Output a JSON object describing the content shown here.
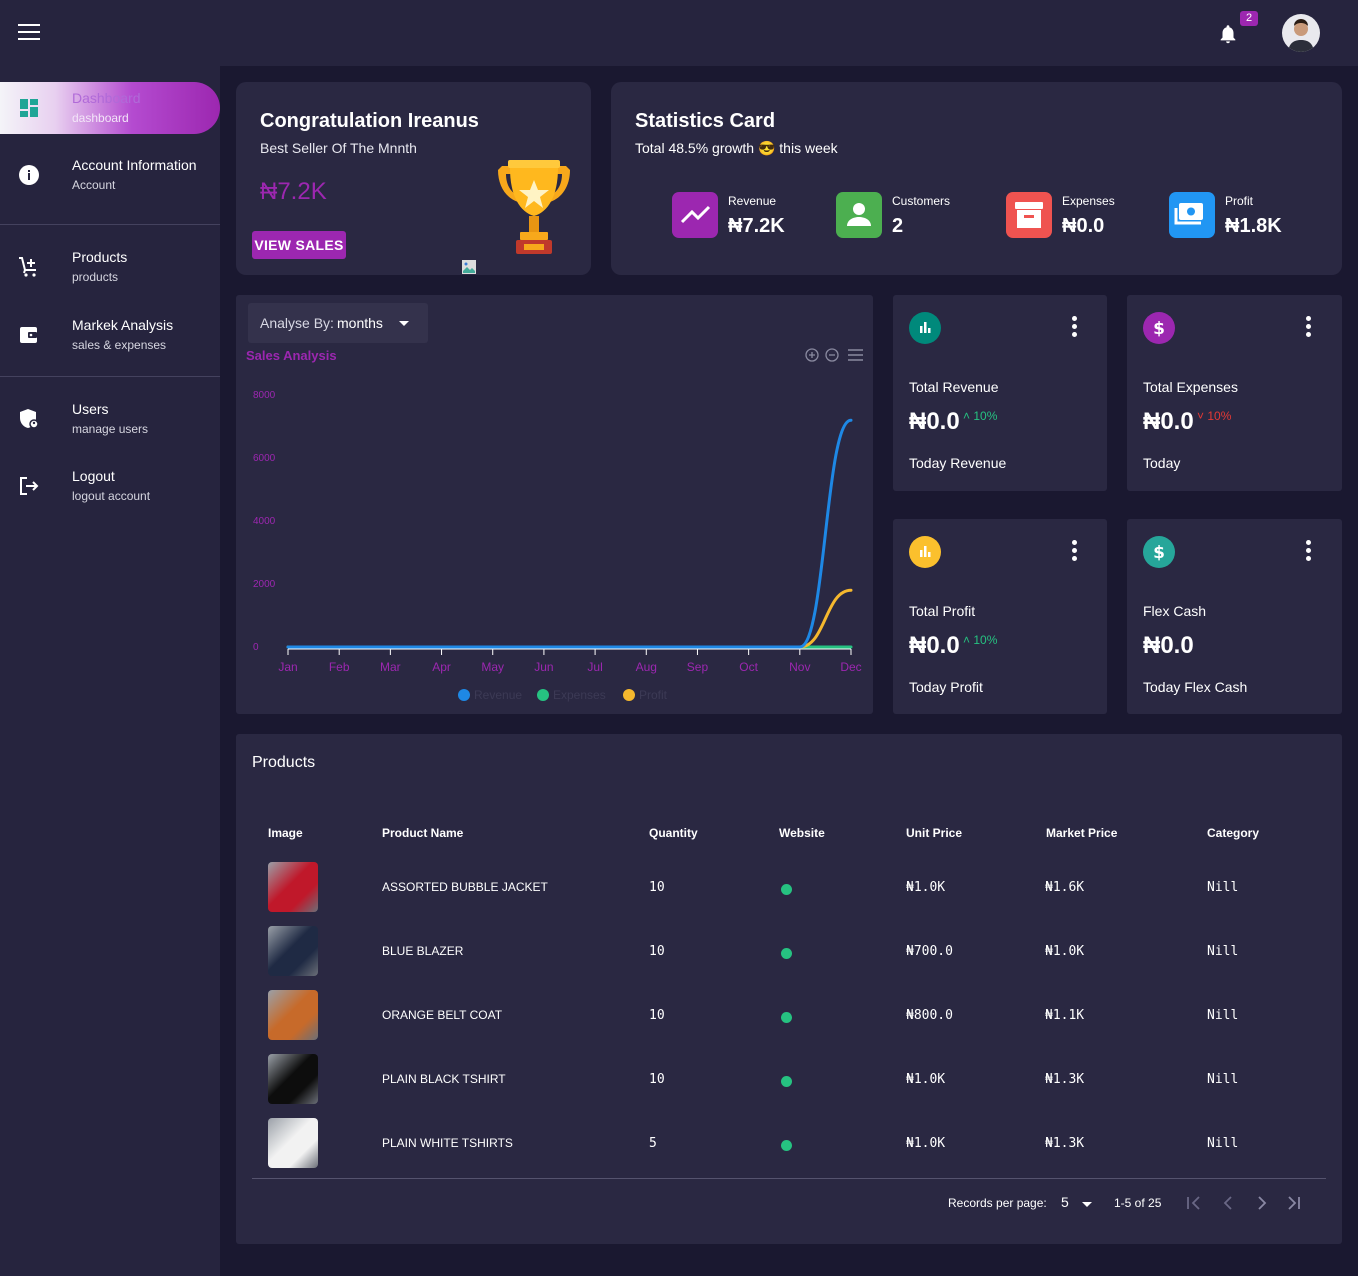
{
  "topbar": {
    "notification_count": "2"
  },
  "sidebar": {
    "items": [
      {
        "label": "Dashboard",
        "sub": "dashboard"
      },
      {
        "label": "Account Information",
        "sub": "Account"
      },
      {
        "label": "Products",
        "sub": "products"
      },
      {
        "label": "Markek Analysis",
        "sub": "sales & expenses"
      },
      {
        "label": "Users",
        "sub": "manage users"
      },
      {
        "label": "Logout",
        "sub": "logout account"
      }
    ]
  },
  "congrats": {
    "title": "Congratulation Ireanus",
    "subtitle": "Best Seller Of The Mnnth",
    "value": "₦7.2K",
    "button": "VIEW SALES"
  },
  "statistics": {
    "title": "Statistics Card",
    "subtitle_before": "Total 48.5% growth",
    "subtitle_emoji": "😎",
    "subtitle_after": "this week",
    "items": [
      {
        "label": "Revenue",
        "value": "₦7.2K",
        "color": "#9c27b0",
        "icon": "trending-up-icon"
      },
      {
        "label": "Customers",
        "value": "2",
        "color": "#4caf50",
        "icon": "person-icon"
      },
      {
        "label": "Expenses",
        "value": "₦0.0",
        "color": "#ef5350",
        "icon": "archive-icon"
      },
      {
        "label": "Profit",
        "value": "₦1.8K",
        "color": "#2196f3",
        "icon": "money-icon"
      }
    ]
  },
  "analysis": {
    "analyse_label": "Analyse By:",
    "analyse_value": "months"
  },
  "chart_data": {
    "type": "line",
    "title": "Sales Analysis",
    "categories": [
      "Jan",
      "Feb",
      "Mar",
      "Apr",
      "May",
      "Jun",
      "Jul",
      "Aug",
      "Sep",
      "Oct",
      "Nov",
      "Dec"
    ],
    "ylim": [
      0,
      8000
    ],
    "yticks": [
      "8000",
      "6000",
      "4000",
      "2000",
      "0"
    ],
    "legend_position": "bottom",
    "series": [
      {
        "name": "Revenue",
        "color": "#1e88e5",
        "values": [
          0,
          0,
          0,
          0,
          0,
          0,
          0,
          0,
          0,
          0,
          0,
          7200
        ]
      },
      {
        "name": "Expenses",
        "color": "#26c281",
        "values": [
          0,
          0,
          0,
          0,
          0,
          0,
          0,
          0,
          0,
          0,
          0,
          0
        ]
      },
      {
        "name": "Profit",
        "color": "#f5b82e",
        "values": [
          0,
          0,
          0,
          0,
          0,
          0,
          0,
          0,
          0,
          0,
          0,
          1800
        ]
      }
    ]
  },
  "mini_cards": [
    {
      "label": "Total Revenue",
      "value": "₦0.0",
      "pct": "10%",
      "trend": "up",
      "sub": "Today Revenue",
      "color": "#00897b",
      "icon": "bar-chart-icon"
    },
    {
      "label": "Total Expenses",
      "value": "₦0.0",
      "pct": "10%",
      "trend": "down",
      "sub": "Today",
      "color": "#9c27b0",
      "icon": "dollar-icon"
    },
    {
      "label": "Total Profit",
      "value": "₦0.0",
      "pct": "10%",
      "trend": "up",
      "sub": "Today Profit",
      "color": "#fbc02d",
      "icon": "bar-chart-icon"
    },
    {
      "label": "Flex Cash",
      "value": "₦0.0",
      "pct": "",
      "trend": "",
      "sub": "Today Flex Cash",
      "color": "#26a69a",
      "icon": "dollar-icon"
    }
  ],
  "products": {
    "title": "Products",
    "columns": [
      "Image",
      "Product Name",
      "Quantity",
      "Website",
      "Unit Price",
      "Market Price",
      "Category"
    ],
    "rows": [
      {
        "name": "ASSORTED BUBBLE JACKET",
        "qty": "10",
        "unit": "₦1.0K",
        "market": "₦1.6K",
        "category": "Nill",
        "thumb": "#c0182a"
      },
      {
        "name": "BLUE BLAZER",
        "qty": "10",
        "unit": "₦700.0",
        "market": "₦1.0K",
        "category": "Nill",
        "thumb": "#1f2a44"
      },
      {
        "name": "ORANGE BELT COAT",
        "qty": "10",
        "unit": "₦800.0",
        "market": "₦1.1K",
        "category": "Nill",
        "thumb": "#c76a2a"
      },
      {
        "name": "PLAIN BLACK TSHIRT",
        "qty": "10",
        "unit": "₦1.0K",
        "market": "₦1.3K",
        "category": "Nill",
        "thumb": "#0d0d0d"
      },
      {
        "name": "PLAIN WHITE TSHIRTS",
        "qty": "5",
        "unit": "₦1.0K",
        "market": "₦1.3K",
        "category": "Nill",
        "thumb": "#f2f2f2"
      }
    ],
    "pagination": {
      "label": "Records per page:",
      "per_page": "5",
      "range": "1-5 of 25"
    }
  }
}
